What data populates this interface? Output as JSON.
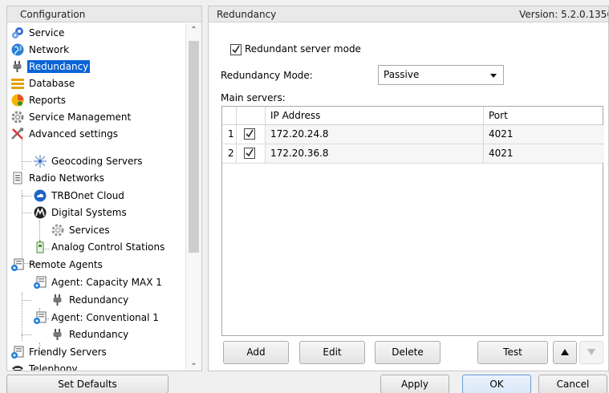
{
  "left_panel": {
    "title": "Configuration",
    "tree": [
      {
        "label": "Service",
        "icon": "service-gears-icon",
        "selected": false
      },
      {
        "label": "Network",
        "icon": "network-globe-icon",
        "selected": false
      },
      {
        "label": "Redundancy",
        "icon": "redundancy-plug-icon",
        "selected": true
      },
      {
        "label": "Database",
        "icon": "database-icon",
        "selected": false
      },
      {
        "label": "Reports",
        "icon": "reports-icon",
        "selected": false
      },
      {
        "label": "Service Management",
        "icon": "gear-icon",
        "selected": false
      },
      {
        "label": "Advanced settings",
        "icon": "tools-icon",
        "selected": false
      },
      {
        "label": "Geocoding Servers",
        "icon": "geocoding-icon",
        "selected": false
      },
      {
        "label": "Radio Networks",
        "icon": "radio-networks-icon",
        "selected": false
      },
      {
        "label": "TRBOnet Cloud",
        "icon": "cloud-icon",
        "selected": false
      },
      {
        "label": "Digital Systems",
        "icon": "motorola-icon",
        "selected": false
      },
      {
        "label": "Services",
        "icon": "gear-icon",
        "selected": false
      },
      {
        "label": "Analog Control Stations",
        "icon": "control-station-icon",
        "selected": false
      },
      {
        "label": "Remote Agents",
        "icon": "remote-agent-icon",
        "selected": false
      },
      {
        "label": "Agent: Capacity MAX 1",
        "icon": "remote-agent-icon",
        "selected": false
      },
      {
        "label": "Redundancy",
        "icon": "redundancy-plug-icon",
        "selected": false
      },
      {
        "label": "Agent: Conventional 1",
        "icon": "remote-agent-icon",
        "selected": false
      },
      {
        "label": "Redundancy",
        "icon": "redundancy-plug-icon",
        "selected": false
      },
      {
        "label": "Friendly Servers",
        "icon": "remote-agent-icon",
        "selected": false
      },
      {
        "label": "Telephony",
        "icon": "telephone-icon",
        "selected": false
      }
    ]
  },
  "right_panel": {
    "title": "Redundancy",
    "version": "Version: 5.2.0.1356",
    "redundant_mode": {
      "label": "Redundant server mode",
      "checked": true
    },
    "mode": {
      "label": "Redundancy Mode:",
      "value": "Passive"
    },
    "main_servers": {
      "label": "Main servers:",
      "columns": [
        "",
        "",
        "IP Address",
        "Port"
      ],
      "rows": [
        {
          "num": "1",
          "checked": true,
          "ip": "172.20.24.8",
          "port": "4021"
        },
        {
          "num": "2",
          "checked": true,
          "ip": "172.20.36.8",
          "port": "4021"
        }
      ]
    },
    "buttons": {
      "add": "Add",
      "edit": "Edit",
      "delete": "Delete",
      "test": "Test"
    }
  },
  "bottom_bar": {
    "set_defaults": "Set Defaults",
    "apply": "Apply",
    "ok": "OK",
    "cancel": "Cancel"
  },
  "colors": {
    "selection": "#0a64d6",
    "accent_border": "#6a9bd8"
  }
}
